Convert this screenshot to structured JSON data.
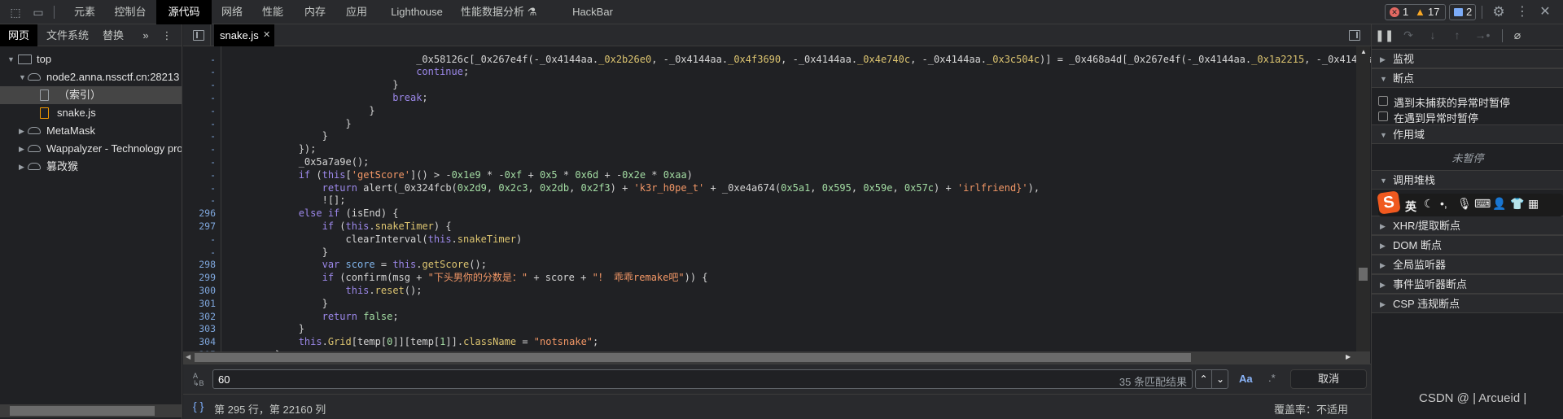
{
  "topbar": {
    "tabs": [
      "元素",
      "控制台",
      "源代码",
      "网络",
      "性能",
      "内存",
      "应用",
      "Lighthouse",
      "性能数据分析",
      "HackBar"
    ],
    "active": "源代码",
    "errors": "1",
    "warnings": "17",
    "messages": "2"
  },
  "navigator": {
    "tabs": [
      "网页",
      "文件系统",
      "替换"
    ],
    "more": "»",
    "tree": [
      {
        "label": "top",
        "icon": "frame-icon"
      },
      {
        "label": "node2.anna.nssctf.cn:28213",
        "icon": "cloud-icon"
      },
      {
        "label": "（索引）",
        "icon": "file-icon"
      },
      {
        "label": "snake.js",
        "icon": "js-file-icon"
      },
      {
        "label": "MetaMask",
        "icon": "cloud-icon"
      },
      {
        "label": "Wappalyzer - Technology profiler",
        "icon": "cloud-icon"
      },
      {
        "label": "篡改猴",
        "icon": "cloud-icon"
      }
    ]
  },
  "editor": {
    "file_tab": "snake.js",
    "lines": [
      {
        "n": "-",
        "c": [
          [
            "p",
            "                                _0x58126c[_0x267e4f(-_0x4144aa."
          ],
          [
            "a",
            "_0x2b26e0"
          ],
          [
            "p",
            ", -_0x4144aa."
          ],
          [
            "a",
            "_0x4f3690"
          ],
          [
            "p",
            ", -_0x4144aa."
          ],
          [
            "a",
            "_0x4e740c"
          ],
          [
            "p",
            ", -_0x4144aa."
          ],
          [
            "a",
            "_0x3c504c"
          ],
          [
            "p",
            ")] = _0x468a4d[_0x267e4f(-_0x4144aa."
          ],
          [
            "a",
            "_0x1a2215"
          ],
          [
            "p",
            ", -_0x4144aa."
          ]
        ]
      },
      {
        "n": "-",
        "c": [
          [
            "p",
            "                                "
          ],
          [
            "k",
            "continue"
          ],
          [
            "p",
            ";"
          ]
        ]
      },
      {
        "n": "-",
        "c": [
          [
            "p",
            "                            }"
          ]
        ]
      },
      {
        "n": "-",
        "c": [
          [
            "p",
            "                            "
          ],
          [
            "k",
            "break"
          ],
          [
            "p",
            ";"
          ]
        ]
      },
      {
        "n": "-",
        "c": [
          [
            "p",
            "                        }"
          ]
        ]
      },
      {
        "n": "-",
        "c": [
          [
            "p",
            "                    }"
          ]
        ]
      },
      {
        "n": "-",
        "c": [
          [
            "p",
            "                }"
          ]
        ]
      },
      {
        "n": "-",
        "c": [
          [
            "p",
            "            });"
          ]
        ]
      },
      {
        "n": "-",
        "c": [
          [
            "p",
            "            _0x5a7a9e();"
          ]
        ]
      },
      {
        "n": "-",
        "c": [
          [
            "p",
            "            "
          ],
          [
            "k",
            "if"
          ],
          [
            "p",
            " ("
          ],
          [
            "k",
            "this"
          ],
          [
            "p",
            "["
          ],
          [
            "s",
            "'getScore'"
          ],
          [
            "p",
            "]() > -"
          ],
          [
            "n",
            "0x1e9"
          ],
          [
            "p",
            " * -"
          ],
          [
            "n",
            "0xf"
          ],
          [
            "p",
            " + "
          ],
          [
            "n",
            "0x5"
          ],
          [
            "p",
            " * "
          ],
          [
            "n",
            "0x6d"
          ],
          [
            "p",
            " + -"
          ],
          [
            "n",
            "0x2e"
          ],
          [
            "p",
            " * "
          ],
          [
            "n",
            "0xaa"
          ],
          [
            "p",
            ")"
          ]
        ]
      },
      {
        "n": "-",
        "c": [
          [
            "p",
            "                "
          ],
          [
            "k",
            "return"
          ],
          [
            "p",
            " alert(_0x324fcb("
          ],
          [
            "n",
            "0x2d9"
          ],
          [
            "p",
            ", "
          ],
          [
            "n",
            "0x2c3"
          ],
          [
            "p",
            ", "
          ],
          [
            "n",
            "0x2db"
          ],
          [
            "p",
            ", "
          ],
          [
            "n",
            "0x2f3"
          ],
          [
            "p",
            ") + "
          ],
          [
            "s",
            "'k3r_h0pe_t'"
          ],
          [
            "p",
            " + _0xe4a674("
          ],
          [
            "n",
            "0x5a1"
          ],
          [
            "p",
            ", "
          ],
          [
            "n",
            "0x595"
          ],
          [
            "p",
            ", "
          ],
          [
            "n",
            "0x59e"
          ],
          [
            "p",
            ", "
          ],
          [
            "n",
            "0x57c"
          ],
          [
            "p",
            ") + "
          ],
          [
            "s",
            "'irlfriend}'"
          ],
          [
            "p",
            "),"
          ]
        ]
      },
      {
        "n": "-",
        "c": [
          [
            "p",
            "                ![];"
          ]
        ]
      },
      {
        "n": "296",
        "c": [
          [
            "p",
            "            "
          ],
          [
            "k",
            "else if"
          ],
          [
            "p",
            " (isEnd) {"
          ]
        ]
      },
      {
        "n": "297",
        "c": [
          [
            "p",
            "                "
          ],
          [
            "k",
            "if"
          ],
          [
            "p",
            " ("
          ],
          [
            "k",
            "this"
          ],
          [
            "p",
            "."
          ],
          [
            "a",
            "snakeTimer"
          ],
          [
            "p",
            ") {"
          ]
        ]
      },
      {
        "n": "-",
        "c": [
          [
            "p",
            "                    clearInterval("
          ],
          [
            "k",
            "this"
          ],
          [
            "p",
            "."
          ],
          [
            "a",
            "snakeTimer"
          ],
          [
            "p",
            ")"
          ]
        ]
      },
      {
        "n": "-",
        "c": [
          [
            "p",
            "                }"
          ]
        ]
      },
      {
        "n": "298",
        "c": [
          [
            "p",
            "                "
          ],
          [
            "k",
            "var"
          ],
          [
            "p",
            " "
          ],
          [
            "v",
            "score"
          ],
          [
            "p",
            " = "
          ],
          [
            "k",
            "this"
          ],
          [
            "p",
            "."
          ],
          [
            "a",
            "getScore"
          ],
          [
            "p",
            "();"
          ]
        ]
      },
      {
        "n": "299",
        "c": [
          [
            "p",
            "                "
          ],
          [
            "k",
            "if"
          ],
          [
            "p",
            " (confirm(msg + "
          ],
          [
            "s",
            "\"下头男你的分数是：\""
          ],
          [
            "p",
            " + score + "
          ],
          [
            "s",
            "\"！ 乖乖remake吧\""
          ],
          [
            "p",
            ")) {"
          ]
        ]
      },
      {
        "n": "300",
        "c": [
          [
            "p",
            "                    "
          ],
          [
            "k",
            "this"
          ],
          [
            "p",
            "."
          ],
          [
            "a",
            "reset"
          ],
          [
            "p",
            "();"
          ]
        ]
      },
      {
        "n": "301",
        "c": [
          [
            "p",
            "                }"
          ]
        ]
      },
      {
        "n": "302",
        "c": [
          [
            "p",
            "                "
          ],
          [
            "k",
            "return"
          ],
          [
            "p",
            " "
          ],
          [
            "n",
            "false"
          ],
          [
            "p",
            ";"
          ]
        ]
      },
      {
        "n": "303",
        "c": [
          [
            "p",
            "            }"
          ]
        ]
      },
      {
        "n": "304",
        "c": [
          [
            "p",
            "            "
          ],
          [
            "k",
            "this"
          ],
          [
            "p",
            "."
          ],
          [
            "a",
            "Grid"
          ],
          [
            "p",
            "[temp["
          ],
          [
            "n",
            "0"
          ],
          [
            "p",
            "]][temp["
          ],
          [
            "n",
            "1"
          ],
          [
            "p",
            "]]."
          ],
          [
            "a",
            "className"
          ],
          [
            "p",
            " = "
          ],
          [
            "s",
            "\"notsnake\""
          ],
          [
            "p",
            ";"
          ]
        ]
      },
      {
        "n": "305",
        "c": [
          [
            "p",
            "        }"
          ]
        ]
      }
    ]
  },
  "search": {
    "value": "60",
    "matches": "35 条匹配结果",
    "case_label": "Aa",
    "regex_label": ".*",
    "cancel": "取消"
  },
  "status": {
    "position": "第 295 行，第 22160 列",
    "coverage": "覆盖率：不适用"
  },
  "debugger": {
    "sections": [
      {
        "label": "监视",
        "open": false
      },
      {
        "label": "断点",
        "open": true
      },
      {
        "label": "作用域",
        "open": true
      },
      {
        "label": "调用堆栈",
        "open": true
      },
      {
        "label": "XHR/提取断点",
        "open": false
      },
      {
        "label": "DOM 断点",
        "open": false
      },
      {
        "label": "全局监听器",
        "open": false
      },
      {
        "label": "事件监听器断点",
        "open": false
      },
      {
        "label": "CSP 违规断点",
        "open": false
      }
    ],
    "checkboxes": [
      {
        "label": "遇到未捕获的异常时暂停",
        "checked": false
      },
      {
        "label": "在遇到异常时暂停",
        "checked": false
      }
    ],
    "scope_status": "未暂停"
  },
  "ime": {
    "lang": "英"
  },
  "watermark": "CSDN @ | Arcueid |",
  "colors": {
    "keyword": "#9c88ea",
    "string": "#f29766",
    "number": "#a3dca3",
    "property": "#dcc470",
    "error": "#e46962",
    "warning": "#f9a825",
    "info": "#7cacf8"
  }
}
